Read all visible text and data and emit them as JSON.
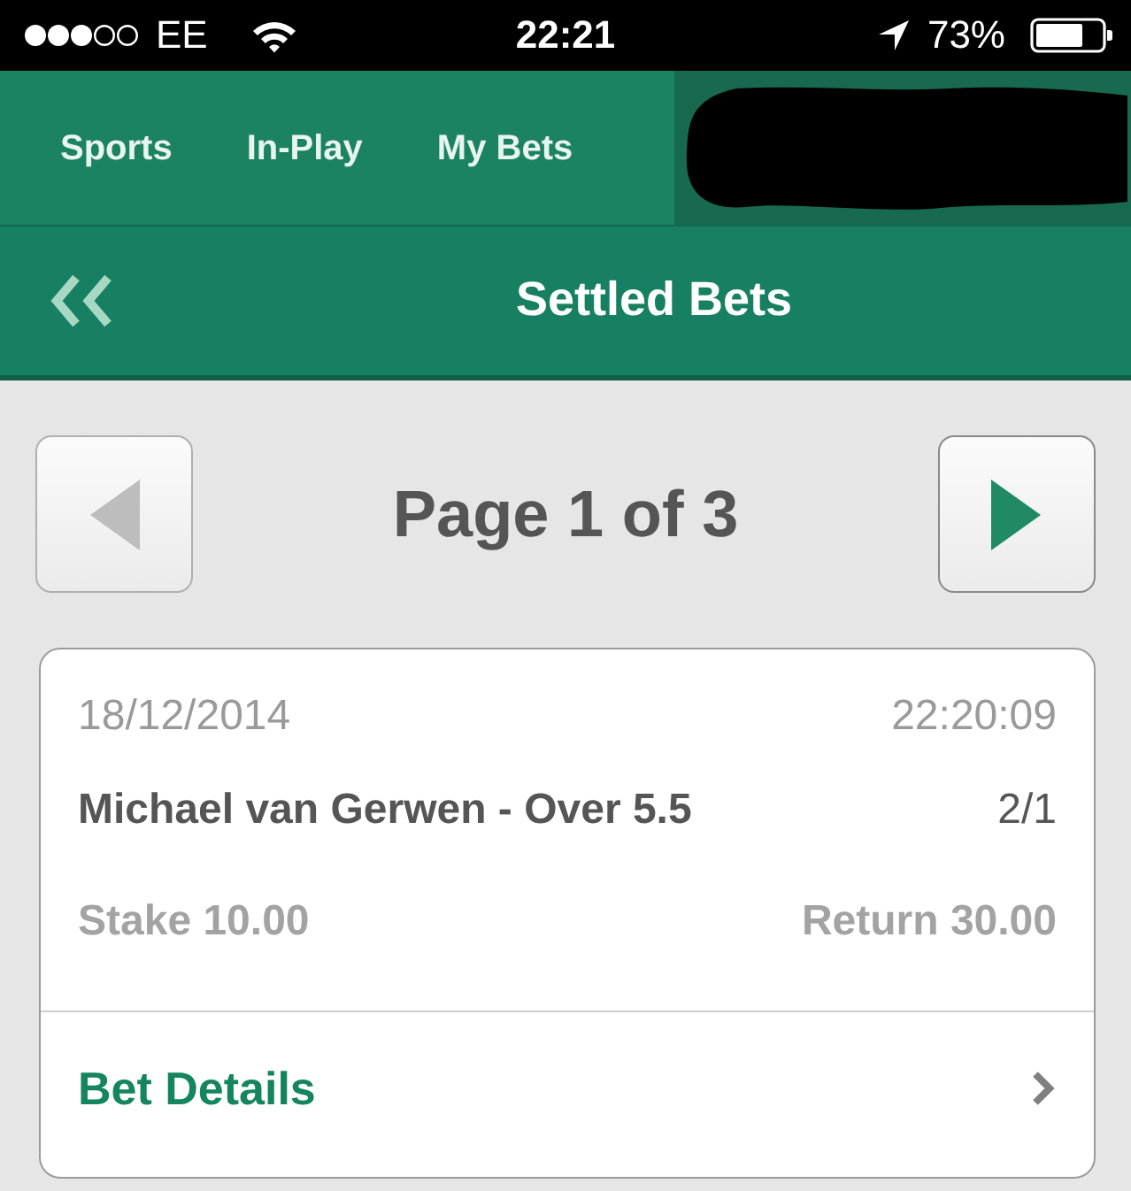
{
  "status_bar": {
    "carrier": "EE",
    "time": "22:21",
    "battery": "73%"
  },
  "nav": {
    "tabs": [
      {
        "label": "Sports",
        "selected": false
      },
      {
        "label": "In-Play",
        "selected": false
      },
      {
        "label": "My Bets",
        "selected": false
      }
    ]
  },
  "header": {
    "title": "Settled Bets"
  },
  "pager": {
    "label": "Page 1 of 3",
    "previous": {
      "disabled": true
    },
    "next": {
      "disabled": false
    }
  },
  "bets": [
    {
      "date": "18/12/2014",
      "time": "22:20:09",
      "selection": "Michael van Gerwen - Over 5.5",
      "odds": "2/1",
      "stake": "Stake 10.00",
      "return": "Return 30.00",
      "details_link": "Bet Details"
    }
  ]
}
